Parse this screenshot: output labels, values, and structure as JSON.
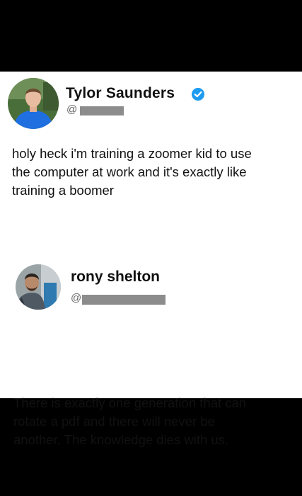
{
  "posts": [
    {
      "author": {
        "name": "Tylor Saunders",
        "handle_prefix": "@",
        "verified": true,
        "verified_color": "#1d9bf0"
      },
      "text_lines": [
        "holy heck i'm training a zoomer kid to use",
        "the computer at work and it's exactly like",
        "training a boomer"
      ]
    },
    {
      "author": {
        "name": "rony shelton",
        "handle_prefix": "@",
        "verified": false
      },
      "text_lines": [
        "There is exactly one generation that can",
        "rotate a pdf and there will never be",
        "another. The knowledge dies with us."
      ]
    }
  ]
}
